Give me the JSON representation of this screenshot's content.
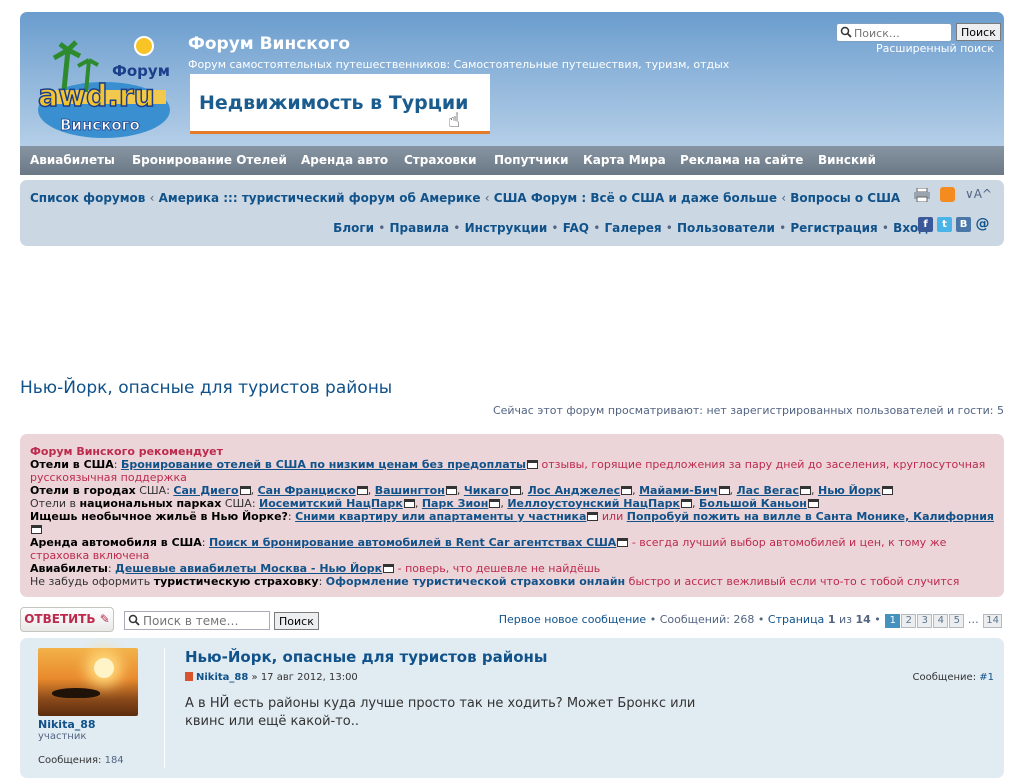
{
  "header": {
    "site_title": "Форум Винского",
    "site_desc": "Форум самостоятельных путешественников: Самостоятельные путешествия, туризм, отдых",
    "banner_text": "Недвижимость в Турции",
    "logo_top": "Форум",
    "logo_main": "awd.ru",
    "logo_bottom": "Винского",
    "search_placeholder": "Поиск…",
    "search_button": "Поиск",
    "advanced_search": "Расширенный поиск"
  },
  "nav": [
    "Авиабилеты",
    "Бронирование Отелей",
    "Аренда авто",
    "Страховки",
    "Попутчики",
    "Карта Мира",
    "Реклама на сайте",
    "Винский"
  ],
  "breadcrumbs": [
    "Список форумов",
    "Америка ::: туристический форум об Америке",
    "США Форум : Всё о США и даже больше",
    "Вопросы о США"
  ],
  "links": [
    "Блоги",
    "Правила",
    "Инструкции",
    "FAQ",
    "Галерея",
    "Пользователи",
    "Регистрация",
    "Вход"
  ],
  "page_title": "Нью-Йорк, опасные для туристов районы",
  "viewing": "Сейчас этот форум просматривают: нет зарегистрированных пользователей и гости: 5",
  "recommend": {
    "title": "Форум Винского рекомендует",
    "hotels_usa_label": "Отели в США",
    "hotels_usa_link": "Бронирование отелей в США по низким ценам без предоплаты",
    "hotels_usa_note": "отзывы, горящие предложения за пару дней до заселения, круглосуточная русскоязычная поддержка",
    "cities_label": "Отели в городах",
    "cities_label2": "США",
    "cities": [
      "Сан Диего",
      "Сан Франциско",
      "Вашингтон",
      "Чикаго",
      "Лос Анджелес",
      "Майами-Бич",
      "Лас Вегас",
      "Нью Йорк"
    ],
    "parks_label": "Отели в",
    "parks_label_b": "национальных парках",
    "parks_label2": "США",
    "parks": [
      "Иосемитский НацПарк",
      "Парк Зион",
      "Иеллоустоунский НацПарк",
      "Большой Каньон"
    ],
    "housing_label": "Ищешь необычное жильё в Нью Йорке?",
    "housing_link1": "Сними квартиру или апартаменты у частника",
    "housing_or": "или",
    "housing_link2": "Попробуй пожить на вилле в Санта Монике, Калифорния",
    "car_label": "Аренда автомобиля в США",
    "car_link": "Поиск и бронирование автомобилей в Rent Car агентствах США",
    "car_note": "- всегда лучший выбор автомобилей и цен, к тому же страховка включена",
    "air_label": "Авиабилеты",
    "air_link": "Дешевые авиабилеты Москва - Нью Йорк",
    "air_note": "- поверь, что дешевле не найдёшь",
    "ins_pre": "Не забудь оформить",
    "ins_label": "туристическую страховку",
    "ins_link": "Оформление туристической страховки онлайн",
    "ins_note": "быстро и ассист вежливый если что-то с тобой случится"
  },
  "actions": {
    "reply": "ОТВЕТИТЬ",
    "topic_search_placeholder": "Поиск в теме…",
    "topic_search_button": "Поиск",
    "first_new": "Первое новое сообщение",
    "messages": "Сообщений: 268",
    "page_word": "Страница",
    "page_cur": "1",
    "page_of": "из",
    "page_total": "14",
    "pages": [
      "1",
      "2",
      "3",
      "4",
      "5"
    ],
    "ellipsis": "…",
    "last_page": "14"
  },
  "post": {
    "author": "Nikita_88",
    "rank": "участник",
    "posts_label": "Сообщения:",
    "posts_count": "184",
    "title": "Нью-Йорк, опасные для туристов районы",
    "date": "17 авг 2012, 13:00",
    "number_label": "Сообщение:",
    "number": "#1",
    "body": "А в НЙ есть районы куда лучше просто так не ходить? Может Бронкс или квинс или ещё какой-то.."
  },
  "colors": {
    "accent": "#105289",
    "reply": "#bc2a4d",
    "recommend_bg": "#ecd5d8",
    "post_bg": "#e1ebf2"
  }
}
